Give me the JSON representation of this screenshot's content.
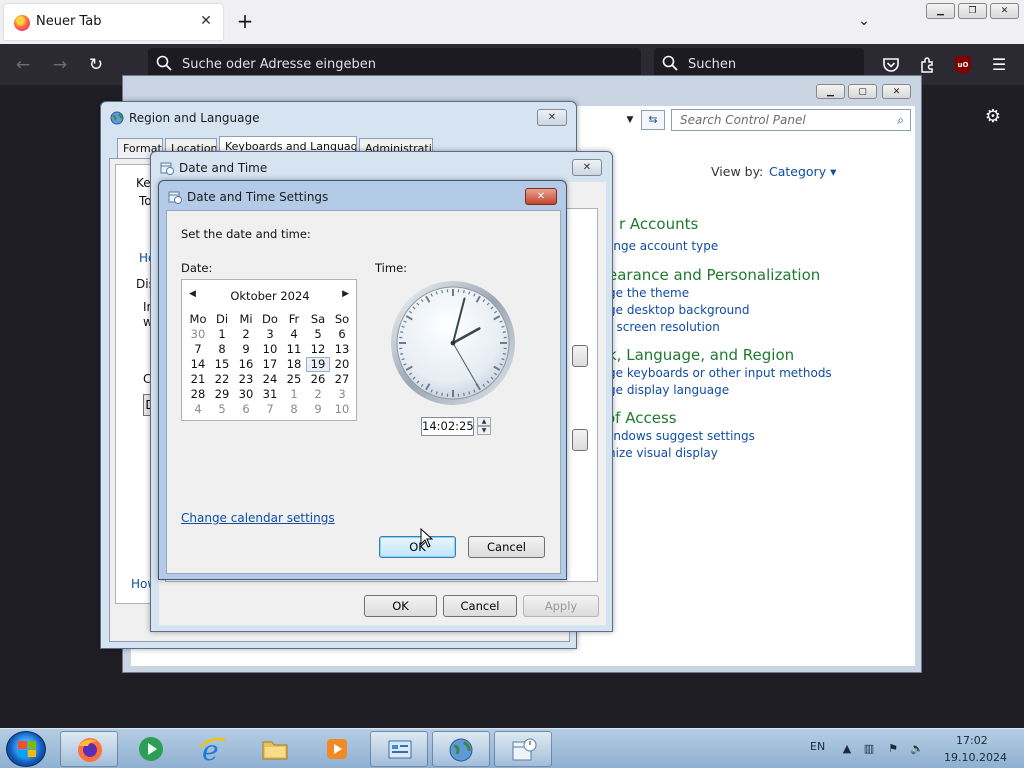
{
  "browser": {
    "tab_title": "Neuer Tab",
    "address_placeholder": "Suche oder Adresse eingeben",
    "search_placeholder": "Suchen"
  },
  "control_panel": {
    "search_placeholder": "Search Control Panel",
    "view_by_label": "View by:",
    "view_by_value": "Category",
    "sections": [
      {
        "title": "r Accounts",
        "links": [
          "ange account type"
        ]
      },
      {
        "title": "earance and Personalization",
        "links": [
          "ge the theme",
          "ge desktop background",
          "t screen resolution"
        ]
      },
      {
        "title": "k, Language, and Region",
        "links": [
          "ge keyboards or other input methods",
          "ge display language"
        ]
      },
      {
        "title": "of Access",
        "links": [
          "indows suggest settings",
          "nize visual display"
        ]
      }
    ]
  },
  "region_dialog": {
    "title": "Region and Language",
    "tabs": [
      "Formats",
      "Location",
      "Keyboards and Languages",
      "Administrative"
    ],
    "fragments": [
      "Ke",
      "To",
      "Ho",
      "Dis",
      "In",
      "w",
      "C",
      "D",
      "How"
    ]
  },
  "datetime_dialog": {
    "title": "Date and Time",
    "ok": "OK",
    "cancel": "Cancel",
    "apply": "Apply"
  },
  "settings_dialog": {
    "title": "Date and Time Settings",
    "instruction": "Set the date and time:",
    "date_label": "Date:",
    "time_label": "Time:",
    "calendar": {
      "month": "Oktober 2024",
      "weekdays": [
        "Mo",
        "Di",
        "Mi",
        "Do",
        "Fr",
        "Sa",
        "So"
      ],
      "days": [
        [
          "30",
          "1",
          "2",
          "3",
          "4",
          "5",
          "6"
        ],
        [
          "7",
          "8",
          "9",
          "10",
          "11",
          "12",
          "13"
        ],
        [
          "14",
          "15",
          "16",
          "17",
          "18",
          "19",
          "20"
        ],
        [
          "21",
          "22",
          "23",
          "24",
          "25",
          "26",
          "27"
        ],
        [
          "28",
          "29",
          "30",
          "31",
          "1",
          "2",
          "3"
        ],
        [
          "4",
          "5",
          "6",
          "7",
          "8",
          "9",
          "10"
        ]
      ],
      "selected_day": "19"
    },
    "time_value": "14:02:25",
    "change_calendar_link": "Change calendar settings",
    "ok": "OK",
    "cancel": "Cancel"
  },
  "taskbar": {
    "language": "EN",
    "time": "17:02",
    "date": "19.10.2024"
  }
}
